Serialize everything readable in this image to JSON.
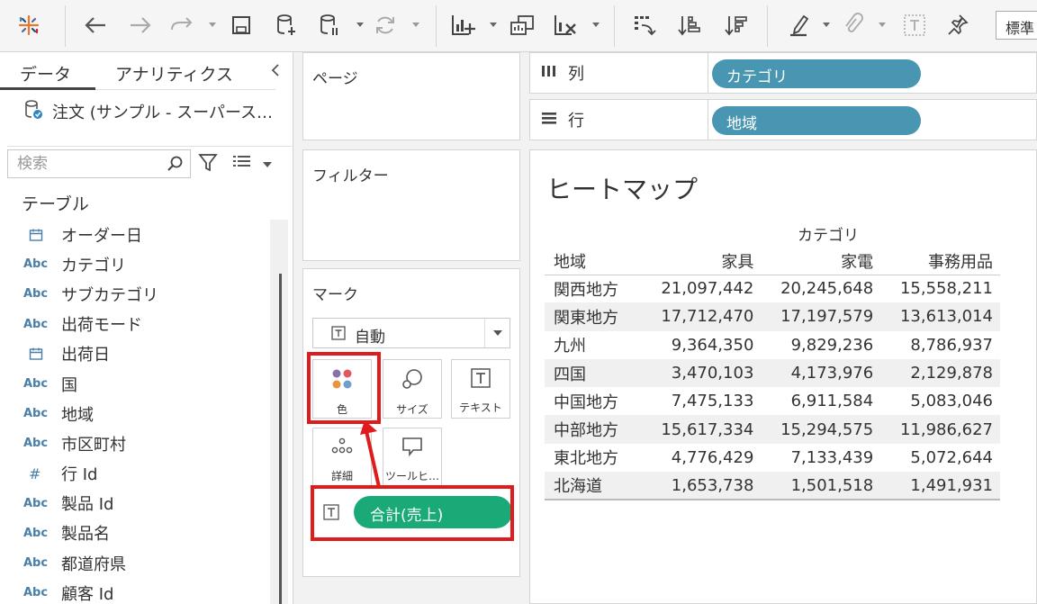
{
  "toolbar": {
    "standard_select": "標準"
  },
  "data_pane": {
    "tabs": [
      "データ",
      "アナリティクス"
    ],
    "datasource": "注文 (サンプル - スーパース…",
    "search_placeholder": "検索",
    "table_heading": "テーブル",
    "fields": [
      {
        "type": "date",
        "name": "オーダー日"
      },
      {
        "type": "Abc",
        "name": "カテゴリ"
      },
      {
        "type": "Abc",
        "name": "サブカテゴリ"
      },
      {
        "type": "Abc",
        "name": "出荷モード"
      },
      {
        "type": "date",
        "name": "出荷日"
      },
      {
        "type": "Abc",
        "name": "国"
      },
      {
        "type": "Abc",
        "name": "地域"
      },
      {
        "type": "Abc",
        "name": "市区町村"
      },
      {
        "type": "#",
        "name": "行 Id"
      },
      {
        "type": "Abc",
        "name": "製品 Id"
      },
      {
        "type": "Abc",
        "name": "製品名"
      },
      {
        "type": "Abc",
        "name": "都道府県"
      },
      {
        "type": "Abc",
        "name": "顧客 Id"
      }
    ]
  },
  "cards": {
    "pages": "ページ",
    "filters": "フィルター",
    "marks": {
      "title": "マーク",
      "mark_type": "自動",
      "buttons": {
        "color": "色",
        "size": "サイズ",
        "text": "テキスト",
        "detail": "詳細",
        "tooltip": "ツールヒ…"
      },
      "pill": "合計(売上)"
    }
  },
  "shelves": {
    "columns": {
      "label": "列",
      "pill": "カテゴリ"
    },
    "rows": {
      "label": "行",
      "pill": "地域"
    }
  },
  "view": {
    "title": "ヒートマップ",
    "column_header": "カテゴリ",
    "headers": [
      "地域",
      "家具",
      "家電",
      "事務用品"
    ],
    "rows": [
      [
        "関西地方",
        "21,097,442",
        "20,245,648",
        "15,558,211"
      ],
      [
        "関東地方",
        "17,712,470",
        "17,197,579",
        "13,613,014"
      ],
      [
        "九州",
        "9,364,350",
        "9,829,236",
        "8,786,937"
      ],
      [
        "四国",
        "3,470,103",
        "4,173,976",
        "2,129,878"
      ],
      [
        "中国地方",
        "7,475,133",
        "6,911,584",
        "5,083,046"
      ],
      [
        "中部地方",
        "15,617,334",
        "15,294,575",
        "11,986,627"
      ],
      [
        "東北地方",
        "4,776,429",
        "7,133,439",
        "5,072,644"
      ],
      [
        "北海道",
        "1,653,738",
        "1,501,518",
        "1,491,931"
      ]
    ]
  },
  "colors": {
    "pill_blue": "#4996b2",
    "pill_green": "#1aaa78",
    "highlight": "#e01b1b"
  }
}
